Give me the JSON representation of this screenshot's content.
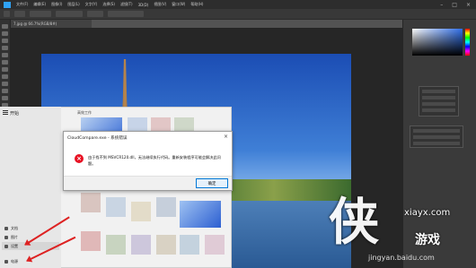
{
  "menubar": {
    "items": [
      "文件(F)",
      "编辑(E)",
      "图像(I)",
      "图层(L)",
      "文字(Y)",
      "选择(S)",
      "滤镜(T)",
      "3D(D)",
      "视图(V)",
      "窗口(W)",
      "帮助(H)"
    ],
    "window_controls": [
      "–",
      "□",
      "×"
    ]
  },
  "document": {
    "tab_label": "7.jpg @ 66.7%(RGB/8#)"
  },
  "start_menu": {
    "title": "开始",
    "tiles_heading": "高效工作",
    "sidebar_items": [
      {
        "label": "文档",
        "icon": "document-icon"
      },
      {
        "label": "图片",
        "icon": "picture-icon"
      },
      {
        "label": "设置",
        "icon": "gear-icon"
      },
      {
        "label": "电源",
        "icon": "power-icon"
      }
    ]
  },
  "dialog": {
    "title": "CloudCompare.exe - 系统错误",
    "close_glyph": "×",
    "message": "由于找不到 MSVCR120.dll，无法继续执行代码。重新安装程序可能会解决此问题。",
    "ok_label": "确定",
    "icon_glyph": "×"
  },
  "watermark": {
    "logo": "侠",
    "site": "xiayx.com",
    "name": "游戏",
    "url": "jingyan.baidu.com"
  },
  "colors": {
    "error_red": "#e81123",
    "accent_blue": "#0078d7",
    "annotation_arrow": "#d22222"
  }
}
